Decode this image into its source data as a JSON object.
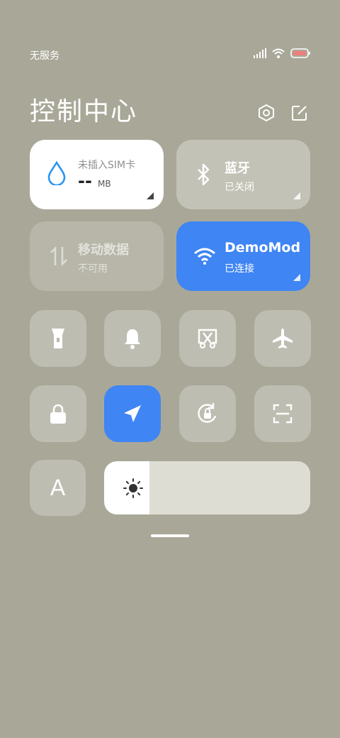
{
  "status": {
    "carrier": "无服务"
  },
  "header": {
    "title": "控制中心"
  },
  "data_tile": {
    "label": "未插入SIM卡",
    "value": "--",
    "unit": "MB"
  },
  "bluetooth_tile": {
    "title": "蓝牙",
    "status": "已关闭"
  },
  "mobile_data_tile": {
    "title": "移动数据",
    "status": "不可用"
  },
  "wifi_tile": {
    "title": "DemoMod",
    "status": "已连接"
  },
  "quick_toggles": [
    {
      "name": "flashlight",
      "active": false
    },
    {
      "name": "bell",
      "active": false
    },
    {
      "name": "screenshot",
      "active": false
    },
    {
      "name": "airplane",
      "active": false
    },
    {
      "name": "lock",
      "active": false
    },
    {
      "name": "location",
      "active": true
    },
    {
      "name": "rotation-lock",
      "active": false
    },
    {
      "name": "scan",
      "active": false
    }
  ],
  "font_button": {
    "label": "A"
  },
  "brightness": {
    "level": 0.22
  },
  "colors": {
    "accent": "#3f85f4",
    "background": "#a9a898",
    "tile_white": "#ffffff"
  }
}
